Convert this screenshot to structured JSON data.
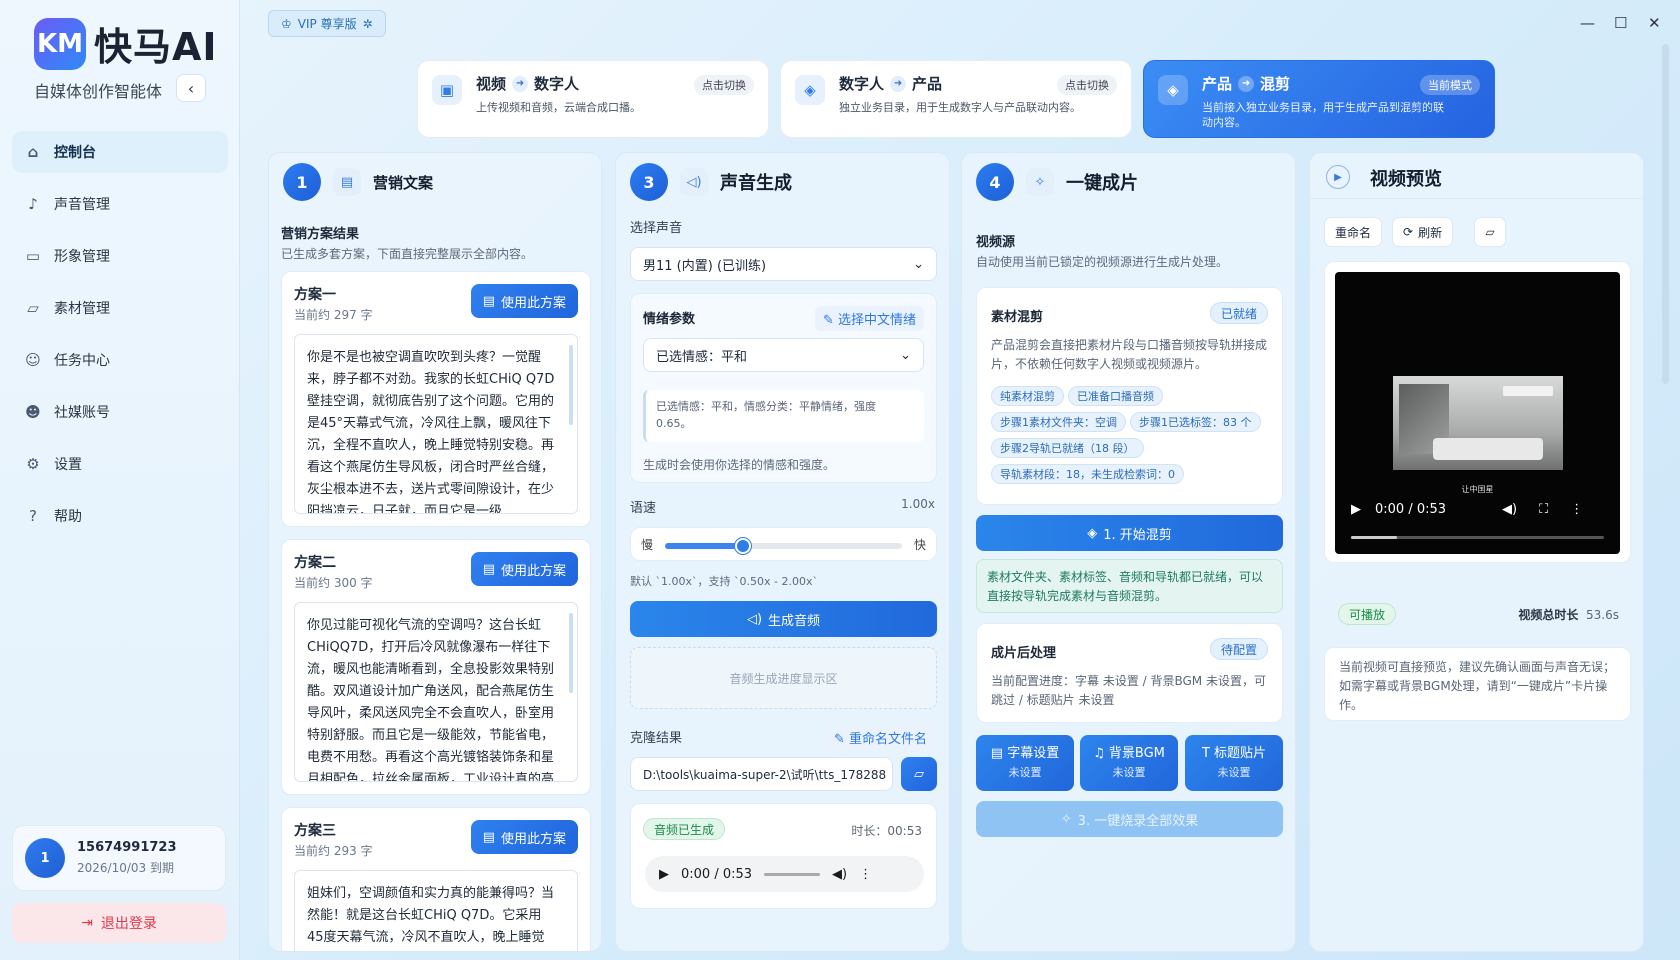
{
  "app": {
    "logo_mark": "KM",
    "name": "快马AI",
    "subtitle": "自媒体创作智能体",
    "collapse": "‹"
  },
  "nav": [
    {
      "label": "控制台",
      "icon": "home-icon",
      "glyph": "⌂"
    },
    {
      "label": "声音管理",
      "icon": "mic-icon",
      "glyph": "♪"
    },
    {
      "label": "形象管理",
      "icon": "video-icon",
      "glyph": "▭"
    },
    {
      "label": "素材管理",
      "icon": "folder-icon",
      "glyph": "▱"
    },
    {
      "label": "任务中心",
      "icon": "users-icon",
      "glyph": "☺"
    },
    {
      "label": "社媒账号",
      "icon": "user-icon",
      "glyph": "☻"
    },
    {
      "label": "设置",
      "icon": "gear-icon",
      "glyph": "⚙"
    },
    {
      "label": "帮助",
      "icon": "help-icon",
      "glyph": "?"
    }
  ],
  "user": {
    "avatar": "1",
    "phone": "15674991723",
    "expire": "2026/10/03 到期"
  },
  "logout": "退出登录",
  "vip": "VIP 尊享版",
  "window": {
    "min": "—",
    "max": "☐",
    "close": "✕"
  },
  "modes": [
    {
      "from": "视频",
      "to": "数字人",
      "desc": "上传视频和音频，云端合成口播。",
      "badge": "点击切换",
      "glyph": "▣"
    },
    {
      "from": "数字人",
      "to": "产品",
      "desc": "独立业务目录，用于生成数字人与产品联动内容。",
      "badge": "点击切换",
      "glyph": "◈"
    },
    {
      "from": "产品",
      "to": "混剪",
      "desc": "当前接入独立业务目录，用于生成产品到混剪的联动内容。",
      "badge": "当前模式",
      "glyph": "◈"
    }
  ],
  "col1": {
    "num": "1",
    "title": "营销文案",
    "result_title": "营销方案结果",
    "result_sub": "已生成多套方案，下面直接完整展示全部内容。",
    "use_label": "使用此方案",
    "plans": [
      {
        "title": "方案一",
        "count": "当前约 297 字",
        "text": "你是不是也被空调直吹吹到头疼？一觉醒来，脖子都不对劲。我家的长虹CHiQ Q7D壁挂空调，就彻底告别了这个问题。它用的是45°天幕式气流，冷风往上飘，暖风往下沉，全程不直吹人，晚上睡觉特别安稳。再看这个燕尾仿生导风板，闭合时严丝合缝，灰尘根本进不去，送片式零间隙设计，在少阳挡凉云，日子就，而且它是一级"
      },
      {
        "title": "方案二",
        "count": "当前约 300 字",
        "text": "你见过能可视化气流的空调吗？这台长虹CHiQQ7D，打开后冷风就像瀑布一样往下流，暖风也能清晰看到，全息投影效果特别酷。双风道设计加广角送风，配合燕尾仿生导风叶，柔风送风完全不会直吹人，卧室用特别舒服。而且它是一级能效，节能省电，电费不用愁。再看这个高光镀铬装饰条和星月相配色，拉丝金属面板，工业设计真的高"
      },
      {
        "title": "方案三",
        "count": "当前约 293 字",
        "text": "姐妹们，空调颜值和实力真的能兼得吗？当然能！就是这台长虹CHiQ Q7D。它采用45度天幕气流，冷风不直吹人，晚上睡觉舒"
      }
    ]
  },
  "col2": {
    "num": "3",
    "title": "声音生成",
    "voice_label": "选择声音",
    "voice_value": "男11 (内置) (已训练)",
    "emotion_title": "情绪参数",
    "emotion_link": "选择中文情绪",
    "emotion_value": "已选情感：平和",
    "emotion_info": "已选情感：平和，情感分类：平静情绪，强度 0.65。",
    "emotion_note": "生成时会使用你选择的情感和强度。",
    "speed_label": "语速",
    "speed_value": "1.00x",
    "speed_slow": "慢",
    "speed_fast": "快",
    "speed_hint": "默认 `1.00x`，支持 `0.50x - 2.00x`",
    "speed_level": 0.33,
    "generate": "生成音频",
    "progress_placeholder": "音频生成进度显示区",
    "clone_label": "克隆结果",
    "rename_link": "重命名文件名",
    "path": "D:\\tools\\kuaima-super-2\\试听\\tts_178288",
    "audio_status": "音频已生成",
    "audio_duration": "时长：00:53",
    "audio_time": "0:00 / 0:53"
  },
  "col3": {
    "num": "4",
    "title": "一键成片",
    "source_title": "视频源",
    "source_sub": "自动使用当前已锁定的视频源进行生成片处理。",
    "mix_title": "素材混剪",
    "mix_badge": "已就绪",
    "mix_desc": "产品混剪会直接把素材片段与口播音频按导轨拼接成片，不依赖任何数字人视频或视频源片。",
    "tags": [
      "纯素材混剪",
      "已准备口播音频",
      "步骤1素材文件夹：空调",
      "步骤1已选标签：83 个",
      "步骤2导轨已就绪（18 段）",
      "导轨素材段：18，未生成检索词：0"
    ],
    "start_mix": "1. 开始混剪",
    "ready_note": "素材文件夹、素材标签、音频和导轨都已就绪，可以直接按导轨完成素材与音频混剪。",
    "post_title": "成片后处理",
    "post_badge": "待配置",
    "post_desc": "当前配置进度：字幕 未设置 / 背景BGM 未设置，可跳过 / 标题贴片 未设置",
    "tools": [
      {
        "label": "字幕设置",
        "sub": "未设置",
        "glyph": "▤"
      },
      {
        "label": "背景BGM",
        "sub": "未设置",
        "glyph": "♫"
      },
      {
        "label": "标题贴片",
        "sub": "未设置",
        "glyph": "T"
      }
    ],
    "burn": "3. 一键烧录全部效果"
  },
  "col4": {
    "title": "视频预览",
    "rename": "重命名",
    "refresh": "刷新",
    "video_caption": "让中国星",
    "video_time": "0:00 / 0:53",
    "status": "可播放",
    "duration_label": "视频总时长",
    "duration": "53.6s",
    "note": "当前视频可直接预览，建议先确认画面与声音无误；如需字幕或背景BGM处理，请到“一键成片”卡片操作。"
  }
}
